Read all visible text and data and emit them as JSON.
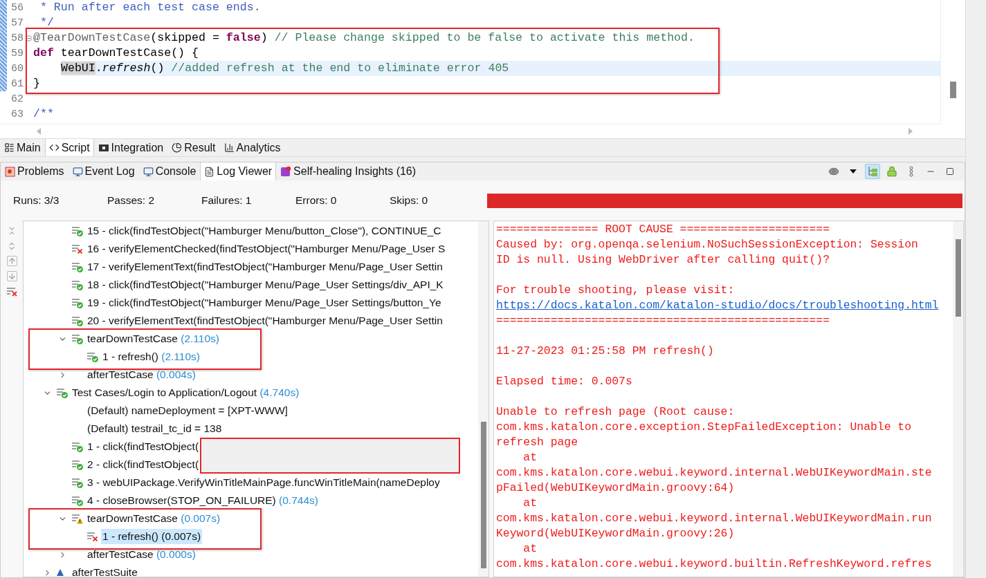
{
  "editor": {
    "lines": [
      {
        "number": "56",
        "changed": true,
        "fold": false,
        "current": false,
        "framed": false,
        "segments": [
          {
            "kind": "doc",
            "text": " * Run after each test case ends."
          }
        ]
      },
      {
        "number": "57",
        "changed": true,
        "fold": false,
        "current": false,
        "framed": false,
        "segments": [
          {
            "kind": "doc",
            "text": " */"
          }
        ]
      },
      {
        "number": "58",
        "changed": true,
        "fold": true,
        "current": false,
        "framed": true,
        "segments": [
          {
            "kind": "annotation",
            "text": "@TearDownTestCase"
          },
          {
            "kind": "plain",
            "text": "(skipped = "
          },
          {
            "kind": "keyword",
            "text": "false"
          },
          {
            "kind": "plain",
            "text": ") "
          },
          {
            "kind": "comment",
            "text": "// Please change skipped to be false to activate this method."
          }
        ]
      },
      {
        "number": "59",
        "changed": true,
        "fold": false,
        "current": false,
        "framed": true,
        "segments": [
          {
            "kind": "keyword",
            "text": "def"
          },
          {
            "kind": "plain",
            "text": " tearDownTestCase() {"
          }
        ]
      },
      {
        "number": "60",
        "changed": true,
        "fold": false,
        "current": true,
        "framed": true,
        "indented": true,
        "segments": [
          {
            "kind": "marked",
            "text": "WebUI"
          },
          {
            "kind": "plain",
            "text": "."
          },
          {
            "kind": "method",
            "text": "refresh"
          },
          {
            "kind": "plain",
            "text": "() "
          },
          {
            "kind": "comment",
            "text": "//added refresh at the end to eliminate error 405"
          }
        ]
      },
      {
        "number": "61",
        "changed": true,
        "fold": false,
        "current": false,
        "framed": true,
        "segments": [
          {
            "kind": "plain",
            "text": "}"
          }
        ]
      },
      {
        "number": "62",
        "changed": false,
        "fold": false,
        "current": false,
        "framed": false
      },
      {
        "number": "63",
        "changed": false,
        "fold": false,
        "current": false,
        "framed": false,
        "segments": [
          {
            "kind": "doc",
            "text": "/**"
          }
        ]
      }
    ]
  },
  "editor_tabs": [
    {
      "label": "Main",
      "selected": false
    },
    {
      "label": "Script",
      "selected": true
    },
    {
      "label": "Integration",
      "selected": false
    },
    {
      "label": "Result",
      "selected": false
    },
    {
      "label": "Analytics",
      "selected": false
    }
  ],
  "panel_tabs": [
    {
      "label": "Problems",
      "selected": false
    },
    {
      "label": "Event Log",
      "selected": false
    },
    {
      "label": "Console",
      "selected": false
    },
    {
      "label": "Log Viewer",
      "selected": true
    },
    {
      "label": "Self-healing Insights (16)",
      "selected": false
    }
  ],
  "stats": [
    "Runs: 3/3",
    "Passes: 2",
    "Failures: 1",
    "Errors: 0",
    "Skips: 0"
  ],
  "progress": {
    "level": 1
  },
  "tree": {
    "continued": [
      {
        "label": "15 - click(findTestObject(\"Hamburger Menu/button_Close\"), CONTINUE_C",
        "kind": "pass",
        "selected": false,
        "framed": false,
        "redacted": false
      },
      {
        "label": "16 - verifyElementChecked(findTestObject(\"Hamburger Menu/Page_User S",
        "kind": "fail",
        "selected": false,
        "framed": false,
        "redacted": false
      },
      {
        "label": "17 - verifyElementText(findTestObject(\"Hamburger Menu/Page_User Settin",
        "kind": "pass",
        "selected": false,
        "framed": false,
        "redacted": false
      },
      {
        "label": "18 - click(findTestObject(\"Hamburger Menu/Page_User Settings/div_API_K",
        "kind": "pass",
        "selected": false,
        "framed": false,
        "redacted": false
      },
      {
        "label": "19 - click(findTestObject(\"Hamburger Menu/Page_User Settings/button_Ye",
        "kind": "pass",
        "selected": false,
        "framed": false,
        "redacted": false
      },
      {
        "label": "20 - verifyElementText(findTestObject(\"Hamburger Menu/Page_User Settin",
        "kind": "pass",
        "selected": false,
        "framed": false,
        "redacted": false
      },
      {
        "label": "tearDownTestCase",
        "duration": "(2.110s)",
        "kind": "pass",
        "expanded": true,
        "selected": false,
        "framed": true,
        "redacted": false,
        "children": [
          {
            "label": "1 - refresh()",
            "duration": "(2.110s)",
            "kind": "pass",
            "selected": false,
            "framed": false,
            "redacted": false
          }
        ]
      },
      {
        "label": "afterTestCase",
        "duration": "(0.004s)",
        "kind": "plain",
        "expanded": false,
        "selected": false,
        "framed": false,
        "redacted": false
      }
    ],
    "nodes": [
      {
        "label": "Test Cases/Login to Application/Logout",
        "duration": "(4.740s)",
        "kind": "pass",
        "expanded": true,
        "selected": false,
        "framed": false,
        "redacted": false,
        "children": [
          {
            "label": "(Default) nameDeployment = [XPT-WWW]",
            "kind": "plain",
            "selected": false,
            "framed": false,
            "redacted": false
          },
          {
            "label": "(Default) testrail_tc_id = 138",
            "kind": "plain",
            "selected": false,
            "framed": false,
            "redacted": false
          },
          {
            "label": "1 - click(findTestObject(",
            "kind": "pass",
            "selected": false,
            "framed": false,
            "redacted": true
          },
          {
            "label": "2 - click(findTestObject(",
            "kind": "pass",
            "selected": false,
            "framed": false,
            "redacted": true
          },
          {
            "label": "3 - webUIPackage.VerifyWinTitleMainPage.funcWinTitleMain(nameDeploy",
            "kind": "pass",
            "selected": false,
            "framed": false,
            "redacted": false
          },
          {
            "label": "4 - closeBrowser(STOP_ON_FAILURE)",
            "duration": "(0.744s)",
            "kind": "pass",
            "selected": false,
            "framed": false,
            "redacted": false
          },
          {
            "label": "tearDownTestCase",
            "duration": "(0.007s)",
            "kind": "warn",
            "expanded": true,
            "selected": false,
            "framed": true,
            "redacted": false,
            "children": [
              {
                "label": "1 - refresh()",
                "duration": "(0.007s)",
                "kind": "fail",
                "selected": true,
                "framed": false,
                "redacted": false
              }
            ]
          },
          {
            "label": "afterTestCase",
            "duration": "(0.000s)",
            "kind": "plain",
            "expanded": false,
            "selected": false,
            "framed": false,
            "redacted": false
          }
        ]
      },
      {
        "label": "afterTestSuite",
        "kind": "suite",
        "expanded": false,
        "selected": false,
        "framed": false,
        "redacted": false
      }
    ]
  },
  "log": {
    "blocks": [
      {
        "lines": [
          {
            "kind": "text",
            "text": "=============== ROOT CAUSE ======================"
          },
          {
            "kind": "text",
            "text": "Caused by: org.openqa.selenium.NoSuchSessionException: Session"
          },
          {
            "kind": "text",
            "text": "ID is null. Using WebDriver after calling quit()?"
          }
        ]
      },
      {
        "lines": [
          {
            "kind": "text",
            "text": "For trouble shooting, please visit:"
          },
          {
            "kind": "link",
            "text": "https://docs.katalon.com/katalon-studio/docs/troubleshooting.html"
          },
          {
            "kind": "text",
            "text": "================================================="
          }
        ]
      },
      {
        "lines": [
          {
            "kind": "text",
            "text": "11-27-2023 01:25:58 PM refresh()"
          }
        ]
      },
      {
        "lines": [
          {
            "kind": "text",
            "text": "Elapsed time: 0.007s"
          }
        ]
      },
      {
        "lines": [
          {
            "kind": "text",
            "text": "Unable to refresh page (Root cause:"
          },
          {
            "kind": "text",
            "text": "com.kms.katalon.core.exception.StepFailedException: Unable to"
          },
          {
            "kind": "text",
            "text": "refresh page"
          },
          {
            "kind": "text",
            "text": "    at"
          },
          {
            "kind": "text",
            "text": "com.kms.katalon.core.webui.keyword.internal.WebUIKeywordMain.ste"
          },
          {
            "kind": "text",
            "text": "pFailed(WebUIKeywordMain.groovy:64)"
          },
          {
            "kind": "text",
            "text": "    at"
          },
          {
            "kind": "text",
            "text": "com.kms.katalon.core.webui.keyword.internal.WebUIKeywordMain.run"
          },
          {
            "kind": "text",
            "text": "Keyword(WebUIKeywordMain.groovy:26)"
          },
          {
            "kind": "text",
            "text": "    at"
          },
          {
            "kind": "text",
            "text": "com.kms.katalon.core.webui.keyword.builtin.RefreshKeyword.refres"
          }
        ]
      }
    ]
  }
}
